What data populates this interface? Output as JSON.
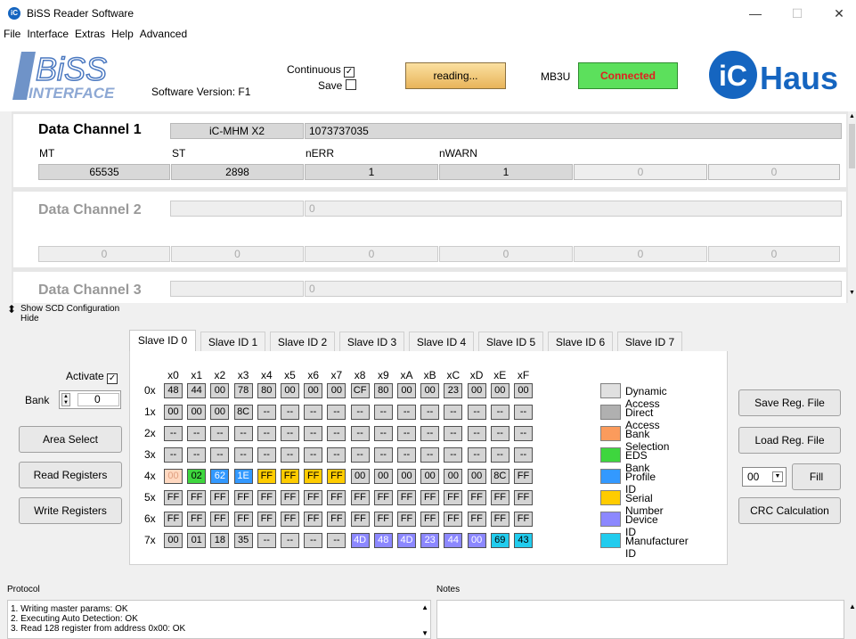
{
  "window": {
    "title": "BiSS Reader Software",
    "min": "—",
    "max": "☐",
    "close": "✕"
  },
  "menu": [
    "File",
    "Interface",
    "Extras",
    "Help",
    "Advanced"
  ],
  "header": {
    "biss_logo_top": "BiSS",
    "biss_logo_bottom": "INTERFACE",
    "software_version": "Software Version: F1",
    "continuous_label": "Continuous",
    "continuous_checked": "✓",
    "save_label": "Save",
    "reading_button": "reading...",
    "mb3u_label": "MB3U",
    "connected_button": "Connected",
    "ichaus_logo_ic": "iC",
    "ichaus_logo_haus": "Haus"
  },
  "channels": [
    {
      "title": "Data Channel 1",
      "device": "iC-MHM X2",
      "value": "1073737035",
      "labels": [
        "MT",
        "ST",
        "nERR",
        "nWARN"
      ],
      "values": [
        "65535",
        "2898",
        "1",
        "1",
        "0",
        "0"
      ]
    },
    {
      "title": "Data Channel 2",
      "device": "",
      "value": "0",
      "values": [
        "0",
        "0",
        "0",
        "0",
        "0",
        "0"
      ]
    },
    {
      "title": "Data Channel 3",
      "device": "",
      "value": "0"
    }
  ],
  "scd": {
    "show": "Show SCD Configuration",
    "hide": "Hide"
  },
  "tabs": [
    "Slave ID 0",
    "Slave ID 1",
    "Slave ID 2",
    "Slave ID 3",
    "Slave ID 4",
    "Slave ID 5",
    "Slave ID 6",
    "Slave ID 7"
  ],
  "left_controls": {
    "activate_label": "Activate",
    "activate_checked": "✓",
    "bank_label": "Bank",
    "bank_value": "0",
    "area_select": "Area Select",
    "read_registers": "Read Registers",
    "write_registers": "Write Registers"
  },
  "registers": {
    "col_headers": [
      "x0",
      "x1",
      "x2",
      "x3",
      "x4",
      "x5",
      "x6",
      "x7",
      "x8",
      "x9",
      "xA",
      "xB",
      "xC",
      "xD",
      "xE",
      "xF"
    ],
    "row_headers": [
      "0x",
      "1x",
      "2x",
      "3x",
      "4x",
      "5x",
      "6x",
      "7x"
    ],
    "rows": [
      [
        "48",
        "44",
        "00",
        "78",
        "80",
        "00",
        "00",
        "00",
        "CF",
        "80",
        "00",
        "00",
        "23",
        "00",
        "00",
        "00"
      ],
      [
        "00",
        "00",
        "00",
        "8C",
        "--",
        "--",
        "--",
        "--",
        "--",
        "--",
        "--",
        "--",
        "--",
        "--",
        "--",
        "--"
      ],
      [
        "--",
        "--",
        "--",
        "--",
        "--",
        "--",
        "--",
        "--",
        "--",
        "--",
        "--",
        "--",
        "--",
        "--",
        "--",
        "--"
      ],
      [
        "--",
        "--",
        "--",
        "--",
        "--",
        "--",
        "--",
        "--",
        "--",
        "--",
        "--",
        "--",
        "--",
        "--",
        "--",
        "--"
      ],
      [
        "00",
        "02",
        "62",
        "1E",
        "FF",
        "FF",
        "FF",
        "FF",
        "00",
        "00",
        "00",
        "00",
        "00",
        "00",
        "8C",
        "FF"
      ],
      [
        "FF",
        "FF",
        "FF",
        "FF",
        "FF",
        "FF",
        "FF",
        "FF",
        "FF",
        "FF",
        "FF",
        "FF",
        "FF",
        "FF",
        "FF",
        "FF"
      ],
      [
        "FF",
        "FF",
        "FF",
        "FF",
        "FF",
        "FF",
        "FF",
        "FF",
        "FF",
        "FF",
        "FF",
        "FF",
        "FF",
        "FF",
        "FF",
        "FF"
      ],
      [
        "00",
        "01",
        "18",
        "35",
        "--",
        "--",
        "--",
        "--",
        "4D",
        "48",
        "4D",
        "23",
        "44",
        "00",
        "69",
        "43"
      ]
    ],
    "types": [
      [
        "D",
        "D",
        "D",
        "D",
        "D",
        "D",
        "D",
        "D",
        "D",
        "D",
        "D",
        "D",
        "D",
        "D",
        "D",
        "D"
      ],
      [
        "D",
        "D",
        "D",
        "D",
        "D",
        "D",
        "D",
        "D",
        "D",
        "D",
        "D",
        "D",
        "D",
        "D",
        "D",
        "D"
      ],
      [
        "D",
        "D",
        "D",
        "D",
        "D",
        "D",
        "D",
        "D",
        "D",
        "D",
        "D",
        "D",
        "D",
        "D",
        "D",
        "D"
      ],
      [
        "D",
        "D",
        "D",
        "D",
        "D",
        "D",
        "D",
        "D",
        "D",
        "D",
        "D",
        "D",
        "D",
        "D",
        "D",
        "D"
      ],
      [
        "B",
        "E",
        "P",
        "P",
        "S",
        "S",
        "S",
        "S",
        "D",
        "D",
        "D",
        "D",
        "D",
        "D",
        "D",
        "D"
      ],
      [
        "D",
        "D",
        "D",
        "D",
        "D",
        "D",
        "D",
        "D",
        "D",
        "D",
        "D",
        "D",
        "D",
        "D",
        "D",
        "D"
      ],
      [
        "D",
        "D",
        "D",
        "D",
        "D",
        "D",
        "D",
        "D",
        "D",
        "D",
        "D",
        "D",
        "D",
        "D",
        "D",
        "D"
      ],
      [
        "D",
        "D",
        "D",
        "D",
        "D",
        "D",
        "D",
        "D",
        "V",
        "V",
        "V",
        "V",
        "V",
        "V",
        "M",
        "M"
      ]
    ]
  },
  "legend": [
    {
      "label": "Dynamic Access",
      "color": "#e0e0e0"
    },
    {
      "label": "Direct Access",
      "color": "#b0b0b0"
    },
    {
      "label": "Bank Selection",
      "color": "#fb9b5c"
    },
    {
      "label": "EDS Bank",
      "color": "#3ed63e"
    },
    {
      "label": "Profile ID",
      "color": "#3399ff"
    },
    {
      "label": "Serial Number",
      "color": "#ffcc00"
    },
    {
      "label": "Device ID",
      "color": "#8c88ff"
    },
    {
      "label": "Manufacturer ID",
      "color": "#22ccee"
    }
  ],
  "type_colors": {
    "D": "#d4d4d4",
    "B": "#ffd8c0",
    "E": "#3ed63e",
    "P": "#3399ff",
    "S": "#ffcc00",
    "V": "#8c88ff",
    "M": "#22ccee"
  },
  "right_controls": {
    "save_reg_file": "Save Reg. File",
    "load_reg_file": "Load Reg. File",
    "fill_value": "00",
    "fill": "Fill",
    "crc": "CRC Calculation"
  },
  "protocol": {
    "label": "Protocol",
    "lines": [
      "1. Writing master params: OK",
      "2. Executing Auto Detection: OK",
      "3. Read 128 register from address 0x00: OK"
    ]
  },
  "notes": {
    "label": "Notes"
  }
}
